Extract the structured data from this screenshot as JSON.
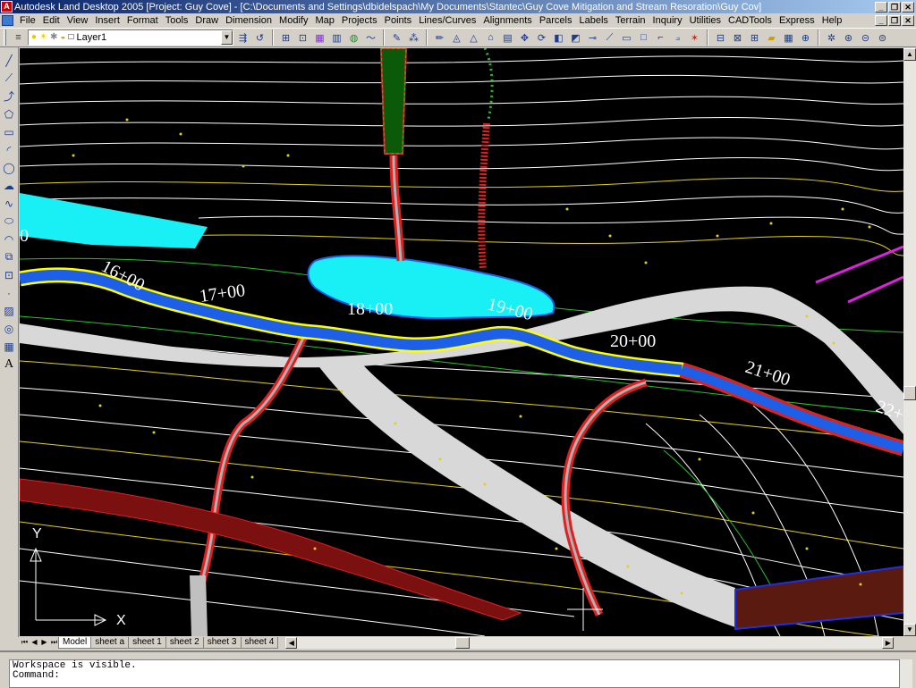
{
  "window": {
    "title": "Autodesk Land Desktop 2005 [Project: Guy Cove] - [C:\\Documents and Settings\\dbidelspach\\My Documents\\Stantec\\Guy Cove Mitigation and Stream Resoration\\Guy Cov]",
    "minimize_icon": "minimize-glyph",
    "restore_icon": "restore-glyph",
    "close_icon": "close-glyph"
  },
  "menu": {
    "items": [
      "File",
      "Edit",
      "View",
      "Insert",
      "Format",
      "Tools",
      "Draw",
      "Dimension",
      "Modify",
      "Map",
      "Projects",
      "Points",
      "Lines/Curves",
      "Alignments",
      "Parcels",
      "Labels",
      "Terrain",
      "Inquiry",
      "Utilities",
      "CADTools",
      "Express",
      "Help"
    ]
  },
  "toolbar": {
    "layer_value": "Layer1"
  },
  "drawing": {
    "station_labels": [
      "16+00",
      "17+00",
      "18+00",
      "19+00",
      "20+00",
      "21+00",
      "22+"
    ],
    "axis_y": "Y",
    "axis_x": "X",
    "colors": {
      "background": "#000000",
      "stream": "#1e5fe8",
      "stream_edge": "#ffff00",
      "pond": "#19f0f5",
      "road": "#d8d8d8",
      "red_line": "#e02020",
      "contour": "#ffffff",
      "yellow_contour": "#e0d020",
      "green_line": "#2bbf2b",
      "magenta": "#e020e0"
    }
  },
  "tabs": {
    "items": [
      "Model",
      "sheet a",
      "sheet 1",
      "sheet 2",
      "sheet 3",
      "sheet 4"
    ],
    "active": "Model"
  },
  "command": {
    "line1": "Workspace is visible.",
    "line2": "Command:"
  }
}
